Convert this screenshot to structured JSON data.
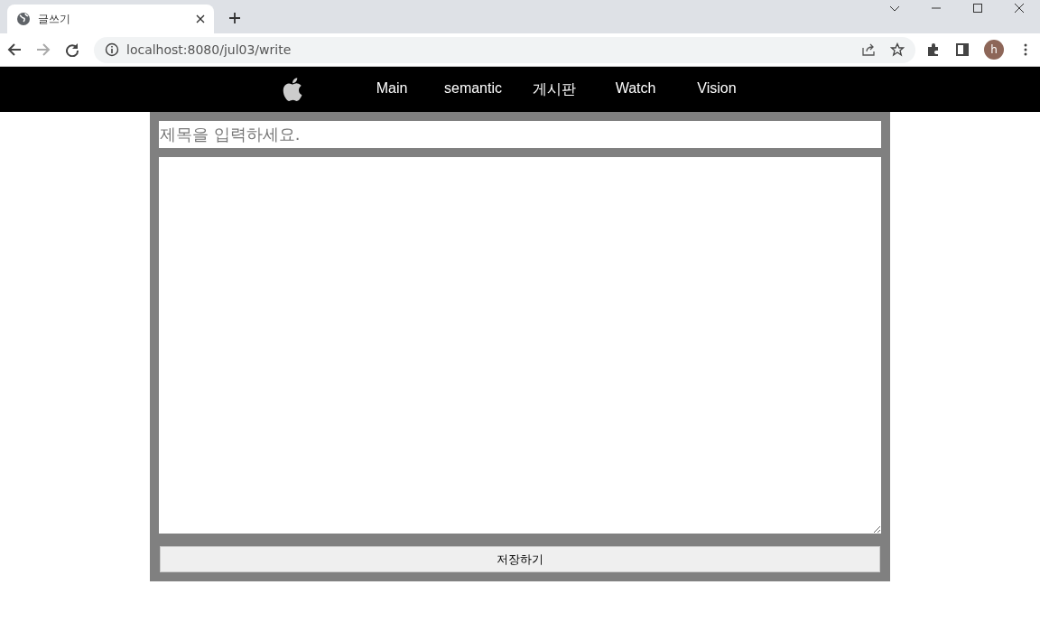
{
  "browser": {
    "tab_title": "글쓰기",
    "url": "localhost:8080/jul03/write",
    "profile_initial": "h"
  },
  "nav": {
    "items": [
      {
        "label": "Main"
      },
      {
        "label": "semantic"
      },
      {
        "label": "게시판"
      },
      {
        "label": "Watch"
      },
      {
        "label": "Vision"
      }
    ]
  },
  "form": {
    "title_placeholder": "제목을 입력하세요.",
    "save_button": "저장하기"
  }
}
